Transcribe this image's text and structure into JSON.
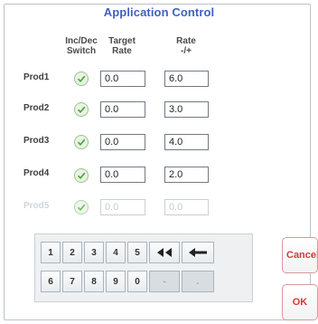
{
  "title": "Application Control",
  "headers": {
    "switch_line1": "Inc/Dec",
    "switch_line2": "Switch",
    "target_line1": "Target",
    "target_line2": "Rate",
    "rate_line1": "Rate",
    "rate_line2": "-/+"
  },
  "products": [
    {
      "label": "Prod1",
      "target": "0.0",
      "rate": "6.0",
      "enabled": true
    },
    {
      "label": "Prod2",
      "target": "0.0",
      "rate": "3.0",
      "enabled": true
    },
    {
      "label": "Prod3",
      "target": "0.0",
      "rate": "4.0",
      "enabled": true
    },
    {
      "label": "Prod4",
      "target": "0.0",
      "rate": "2.0",
      "enabled": true
    },
    {
      "label": "Prod5",
      "target": "0.0",
      "rate": "0.0",
      "enabled": false
    }
  ],
  "keypad": {
    "row1": [
      "1",
      "2",
      "3",
      "4",
      "5",
      "⯬",
      "←"
    ],
    "row2": [
      "6",
      "7",
      "8",
      "9",
      "0",
      "-",
      "."
    ]
  },
  "buttons": {
    "cancel": "Cancel",
    "ok": "OK"
  },
  "colors": {
    "title": "#3f62c0",
    "cancel_text": "#d13a3a",
    "check_green": "#4aa33a"
  }
}
